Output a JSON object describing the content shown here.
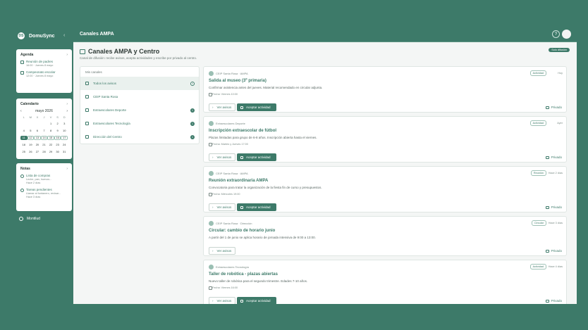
{
  "app": {
    "logo_initials": "DS",
    "name": "DomuSync",
    "collapse_icon": "chevron-left-icon"
  },
  "topbar": {
    "title": "Canales AMPA",
    "help_icon": "?"
  },
  "agenda": {
    "title": "Agenda",
    "events": [
      {
        "title": "Reunión de padres",
        "meta": "16:00 · Jueves 8 mayo"
      },
      {
        "title": "Campeonato escolar",
        "meta": "12:00 · Jueves 8 mayo"
      }
    ]
  },
  "calendar": {
    "title": "Calendario",
    "month": "mayo 2026",
    "weekdays": [
      "L",
      "M",
      "X",
      "J",
      "V",
      "S",
      "D"
    ],
    "rows": [
      [
        "",
        "",
        "",
        "",
        "1",
        "2",
        "3"
      ],
      [
        "4",
        "5",
        "6",
        "7",
        "8",
        "9",
        "10"
      ],
      [
        "11",
        "12",
        "13",
        "14",
        "15",
        "16",
        "17"
      ],
      [
        "18",
        "19",
        "20",
        "21",
        "22",
        "23",
        "24"
      ],
      [
        "25",
        "26",
        "27",
        "28",
        "29",
        "30",
        "31"
      ]
    ],
    "today": "11",
    "marked": [
      "12",
      "13",
      "14",
      "15",
      "16",
      "17"
    ]
  },
  "notes": {
    "title": "Notas",
    "items": [
      {
        "title": "Lista de compras",
        "sub": "Leche, pan, huevos...",
        "time": "Hace 2 días"
      },
      {
        "title": "Tareas pendientes",
        "sub": "Llamar al fontanero, revisar...",
        "time": "Hace 3 días"
      }
    ]
  },
  "sidebar_user": {
    "label": "Montilud"
  },
  "page": {
    "title": "Canales AMPA y Centro",
    "subtitle": "Canal de difusión: recibe avisos, acepta actividades y escribe por privado al centro.",
    "badge": "Solo difusión"
  },
  "channels": {
    "title": "Mis canales",
    "items": [
      {
        "label": "Todos los avisos",
        "count": "4",
        "active": true
      },
      {
        "label": "CEIP Santa Rosa",
        "count": ""
      },
      {
        "label": "Extraescolares Deporte",
        "count": "1"
      },
      {
        "label": "Extraescolares Tecnología",
        "count": "1"
      },
      {
        "label": "Dirección del Centro",
        "count": "1"
      }
    ]
  },
  "posts": [
    {
      "source": "CEIP Santa Rosa · AMPA",
      "tag": "Actividad",
      "time": "Hoy",
      "title": "Salida al museo (3º primaria)",
      "desc": "Confirmar asistencia antes del jueves. Material recomendado en circular adjunta.",
      "date": "Fecha: Viernes 10:00",
      "ver": "Ver avisos",
      "accept": "Aceptar actividad",
      "private": "Privado"
    },
    {
      "source": "Extraescolares Deporte",
      "tag": "Actividad",
      "time": "Ayer",
      "title": "Inscripción extraescolar de fútbol",
      "desc": "Plazas limitadas para grupo de 6-8 años. Inscripción abierta hasta el viernes.",
      "date": "Fecha: Martes y Jueves 17:00",
      "ver": "Ver avisos",
      "accept": "Aceptar actividad",
      "private": "Privado"
    },
    {
      "source": "CEIP Santa Rosa · AMPA",
      "tag": "Reunión",
      "time": "Hace 2 días",
      "title": "Reunión extraordinaria AMPA",
      "desc": "Convocatoria para tratar la organización de la fiesta fin de curso y presupuestos.",
      "date": "Fecha: Miércoles 19:00",
      "ver": "Ver avisos",
      "accept": "Aceptar actividad",
      "private": "Privado"
    },
    {
      "source": "CEIP Santa Rosa · Dirección",
      "tag": "Circular",
      "time": "Hace 3 días",
      "title": "Circular: cambio de horario junio",
      "desc": "A partir del 1 de junio se aplica horario de jornada intensiva de 9:00 a 13:00.",
      "date": "",
      "ver": "Ver avisos",
      "accept": "",
      "private": "Privado"
    },
    {
      "source": "Extraescolares Tecnología",
      "tag": "Actividad",
      "time": "Hace 4 días",
      "title": "Taller de robótica - plazas abiertas",
      "desc": "Nuevo taller de robótica para el segundo trimestre. Edades 7-10 años.",
      "date": "Fecha: Viernes 16:00",
      "ver": "Ver avisos",
      "accept": "Aceptar actividad",
      "private": "Privado"
    }
  ]
}
